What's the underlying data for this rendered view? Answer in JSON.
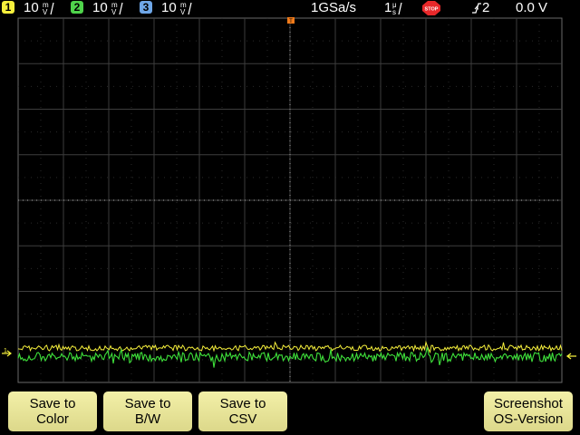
{
  "status": {
    "channels": [
      {
        "num": "1",
        "scale": "10",
        "color": "#f5ef3c"
      },
      {
        "num": "2",
        "scale": "10",
        "color": "#4fd44b"
      },
      {
        "num": "3",
        "scale": "10",
        "color": "#6fa7e8"
      }
    ],
    "sample_rate": "1GSa/s",
    "timebase": "1",
    "run_state": "STOP",
    "trigger_channel": "2",
    "trigger_level": "0.0 V"
  },
  "softkeys": [
    {
      "line1": "Save to",
      "line2": "Color"
    },
    {
      "line1": "Save to",
      "line2": "B/W"
    },
    {
      "line1": "Save to",
      "line2": "CSV"
    },
    {
      "line1": "Screenshot",
      "line2": "OS-Version"
    }
  ],
  "traces": {
    "ch1_color": "#f5ef3c",
    "ch2_color": "#3ee03a"
  },
  "markers": {
    "ground_label": "1"
  }
}
